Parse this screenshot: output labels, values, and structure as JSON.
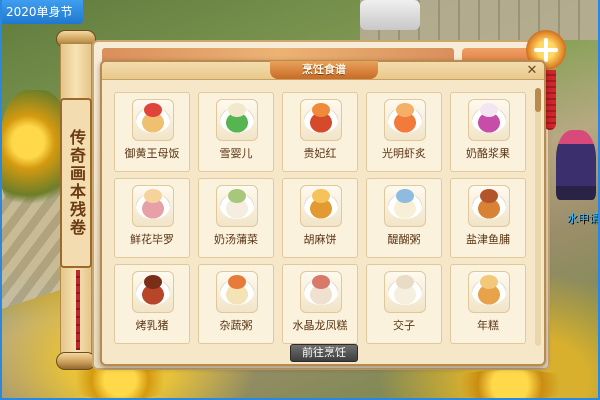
{
  "event_tag": "2020单身节",
  "scroll_label": "传奇画本残卷",
  "npc_chat": "水申请",
  "dialog": {
    "title": "烹饪食谱",
    "close_symbol": "✕",
    "go_button": "前往烹饪"
  },
  "recipes": [
    {
      "name": "御黄王母饭",
      "icon": "cake-dish-icon",
      "food": "#f0c071",
      "food2": "#e0443a"
    },
    {
      "name": "雪婴儿",
      "icon": "jelly-dish-icon",
      "food": "#56b550",
      "food2": "#f2e8cc"
    },
    {
      "name": "贵妃红",
      "icon": "red-meatball-dish-icon",
      "food": "#d64a2c",
      "food2": "#f08a3a"
    },
    {
      "name": "光明虾炙",
      "icon": "shrimp-dish-icon",
      "food": "#f27a3a",
      "food2": "#f5b068"
    },
    {
      "name": "奶酪浆果",
      "icon": "berry-dish-icon",
      "food": "#c74ea8",
      "food2": "#f4e5f2"
    },
    {
      "name": "鲜花毕罗",
      "icon": "pastry-dish-icon",
      "food": "#e8a0a8",
      "food2": "#f6d39a"
    },
    {
      "name": "奶汤蒲菜",
      "icon": "soup-dish-icon",
      "food": "#f4ede0",
      "food2": "#a7c87a"
    },
    {
      "name": "胡麻饼",
      "icon": "sesame-cake-icon",
      "food": "#e39a32",
      "food2": "#f6c25a"
    },
    {
      "name": "醍醐粥",
      "icon": "porridge-bowl-icon",
      "food": "#f7efd6",
      "food2": "#8fbbe0"
    },
    {
      "name": "盐津鱼脯",
      "icon": "fish-dish-icon",
      "food": "#d88236",
      "food2": "#b2552a"
    },
    {
      "name": "烤乳猪",
      "icon": "roast-pig-icon",
      "food": "#b8452a",
      "food2": "#7a2e18"
    },
    {
      "name": "杂蔬粥",
      "icon": "veggie-porridge-icon",
      "food": "#f3e3b5",
      "food2": "#e97b3a"
    },
    {
      "name": "水晶龙凤糕",
      "icon": "crystal-cake-icon",
      "food": "#f0e0d0",
      "food2": "#d77a6a"
    },
    {
      "name": "交子",
      "icon": "dumplings-icon",
      "food": "#f6efe0",
      "food2": "#e8dcc4"
    },
    {
      "name": "年糕",
      "icon": "rice-cake-icon",
      "food": "#e8a24a",
      "food2": "#f2c87a"
    }
  ]
}
